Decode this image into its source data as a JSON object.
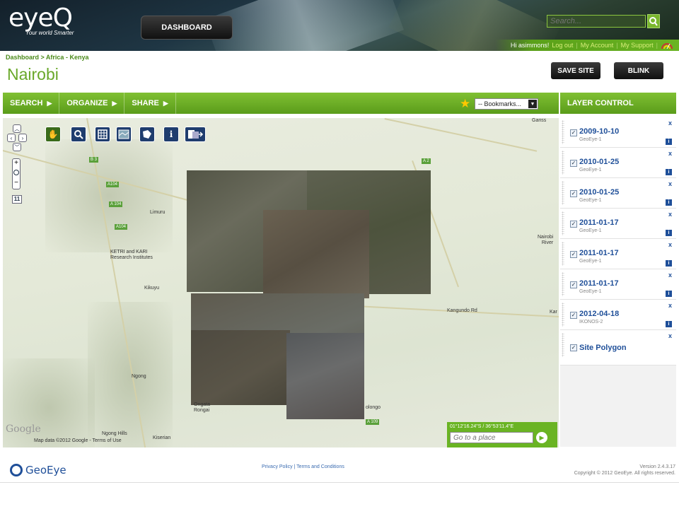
{
  "header": {
    "logo_text": "eyeQ",
    "logo_tagline": "Your world Smarter",
    "dashboard_label": "DASHBOARD",
    "search_placeholder": "Search...",
    "greeting": "Hi asimmons!",
    "logout": "Log out",
    "my_account": "My Account",
    "my_support": "My Support"
  },
  "breadcrumb": "Dashboard > Africa - Kenya",
  "page_title": "Nairobi",
  "actions": {
    "save_site": "SAVE SITE",
    "blink": "BLINK"
  },
  "toolbar": {
    "items": [
      "SEARCH",
      "ORGANIZE",
      "SHARE"
    ],
    "bookmarks_value": "-- Bookmarks..."
  },
  "layer_control": {
    "title": "LAYER CONTROL",
    "layers": [
      {
        "date": "2009-10-10",
        "sensor": "GeoEye-1",
        "checked": true
      },
      {
        "date": "2010-01-25",
        "sensor": "GeoEye-1",
        "checked": true
      },
      {
        "date": "2010-01-25",
        "sensor": "GeoEye-1",
        "checked": true
      },
      {
        "date": "2011-01-17",
        "sensor": "GeoEye-1",
        "checked": true
      },
      {
        "date": "2011-01-17",
        "sensor": "GeoEye-1",
        "checked": true
      },
      {
        "date": "2011-01-17",
        "sensor": "GeoEye-1",
        "checked": true
      },
      {
        "date": "2012-04-18",
        "sensor": "IKONOS-2",
        "checked": true
      }
    ],
    "site_polygon": "Site Polygon",
    "remove_label": "x",
    "info_label": "i"
  },
  "map": {
    "zoom_level": "11",
    "labels": {
      "limuru": "Limuru",
      "ketri": "KETRI and KARI\nResearch Institutes",
      "kikuyu": "Kikuyu",
      "ngong": "Ngong",
      "ongata": "Ongata\nRongai",
      "ngong_hills": "Ngong Hills",
      "kiserian": "Kiserian",
      "nairobi_river": "Nairobi\nRiver",
      "kangundo": "Kangundo Rd",
      "kar": "Kar",
      "olongo": "olongo",
      "garissa": "Gariss",
      "b3": "B 3",
      "a104a": "A104",
      "a104b": "A 104",
      "a104c": "A104",
      "a2": "A 2",
      "a109": "A 109"
    },
    "google": "Google",
    "attribution": "Map data ©2012 Google - Terms of Use",
    "coords": "01°12'16.24\"S / 36°53'11.4\"E",
    "goto_placeholder": "Go to a place"
  },
  "footer": {
    "logo": "GeoEye",
    "links": "Privacy Policy | Terms and Conditions",
    "version": "Version 2.4.3.17",
    "copyright": "Copyright © 2012 GeoEye. All rights reserved."
  },
  "colors": {
    "brand_green": "#6ab423",
    "link_blue": "#1f4f99",
    "dark": "#111111"
  }
}
